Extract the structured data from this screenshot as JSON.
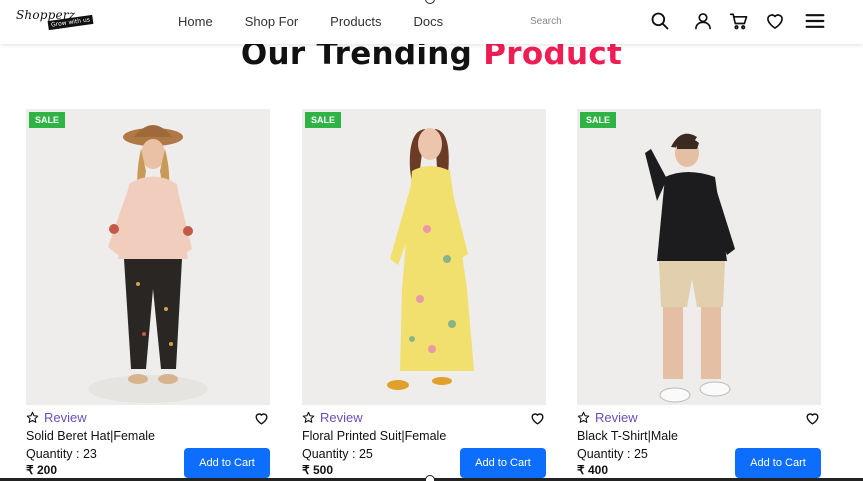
{
  "navbar": {
    "logo_main": "Shopperz",
    "logo_tag": "Grow with us",
    "links": [
      {
        "label": "Home"
      },
      {
        "label": "Shop For"
      },
      {
        "label": "Products"
      },
      {
        "label": "Docs"
      }
    ],
    "search_placeholder": "Search",
    "icons": [
      "search-icon",
      "user-icon",
      "cart-icon",
      "heart-icon",
      "menu-icon"
    ]
  },
  "section": {
    "title_main": "Our Trending",
    "title_accent": "Product",
    "accent_color": "#ee1e54"
  },
  "products": [
    {
      "badge": "SALE",
      "review_label": "Review",
      "name": "Solid Beret Hat|Female",
      "quantity_label": "Quantity : 23",
      "currency": "₹",
      "price": "200",
      "button_label": "Add to Cart"
    },
    {
      "badge": "SALE",
      "review_label": "Review",
      "name": "Floral Printed Suit|Female",
      "quantity_label": "Quantity : 25",
      "currency": "₹",
      "price": "500",
      "button_label": "Add to Cart"
    },
    {
      "badge": "SALE",
      "review_label": "Review",
      "name": "Black T-Shirt|Male",
      "quantity_label": "Quantity : 25",
      "currency": "₹",
      "price": "400",
      "button_label": "Add to Cart"
    }
  ],
  "colors": {
    "sale_badge": "#2fb344",
    "button": "#0d6efd",
    "review_link": "#6b4fbb"
  }
}
